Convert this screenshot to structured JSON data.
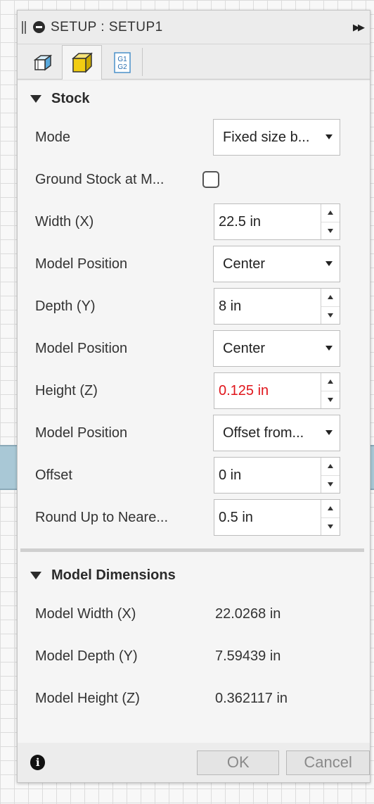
{
  "dialog": {
    "title": "SETUP : SETUP1",
    "tabs": [
      {
        "name": "setup-tab",
        "icon": "box-outline-icon"
      },
      {
        "name": "stock-tab",
        "icon": "yellow-cube-icon",
        "active": true
      },
      {
        "name": "post-process-tab",
        "icon": "g1-g2-icon",
        "text_top": "G1",
        "text_bottom": "G2"
      }
    ]
  },
  "stock": {
    "heading": "Stock",
    "mode": {
      "label": "Mode",
      "value": "Fixed size b..."
    },
    "ground_stock": {
      "label": "Ground Stock at M...",
      "checked": false
    },
    "width": {
      "label": "Width (X)",
      "value": "22.5 in"
    },
    "width_position": {
      "label": "Model Position",
      "value": "Center"
    },
    "depth": {
      "label": "Depth (Y)",
      "value": "8 in"
    },
    "depth_position": {
      "label": "Model Position",
      "value": "Center"
    },
    "height": {
      "label": "Height (Z)",
      "value": "0.125 in",
      "color": "#e0151b"
    },
    "height_position": {
      "label": "Model Position",
      "value": "Offset from..."
    },
    "offset": {
      "label": "Offset",
      "value": "0 in"
    },
    "round_up": {
      "label": "Round Up to Neare...",
      "value": "0.5 in"
    }
  },
  "model_dimensions": {
    "heading": "Model Dimensions",
    "width": {
      "label": "Model Width (X)",
      "value": "22.0268 in"
    },
    "depth": {
      "label": "Model Depth (Y)",
      "value": "7.59439 in"
    },
    "height": {
      "label": "Model Height (Z)",
      "value": "0.362117 in"
    }
  },
  "footer": {
    "ok_label": "OK",
    "cancel_label": "Cancel",
    "info_glyph": "i"
  },
  "colors": {
    "error_value": "#e0151b",
    "background_band": "#a9c8d6"
  }
}
